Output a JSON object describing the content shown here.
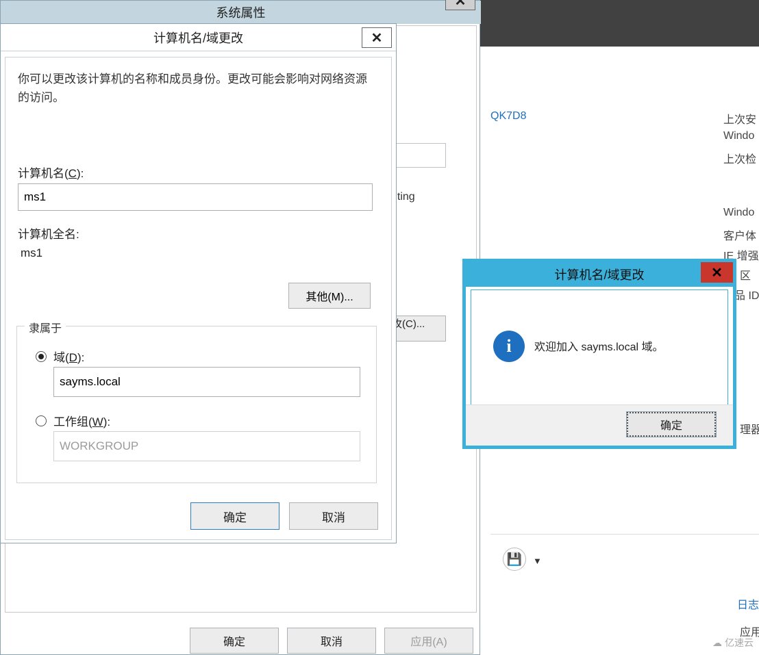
{
  "background": {
    "computer_link": "QK7D8",
    "labels": {
      "last_install": "上次安",
      "windows": "Windo",
      "last_check": "上次检",
      "windo2": "Windo",
      "customer": "客户体",
      "ie_enhance": "IE 增强",
      "zone": "区",
      "product_id": "品 ID",
      "processor": "理器",
      "log": "日志",
      "app": "应用"
    },
    "network_hint": "nting",
    "change_button_partial": "攻(C)..."
  },
  "system_properties": {
    "title": "系统属性",
    "close": "✕",
    "ok": "确定",
    "cancel": "取消",
    "apply": "应用(A)"
  },
  "name_change": {
    "title": "计算机名/域更改",
    "close": "✕",
    "description": "你可以更改该计算机的名称和成员身份。更改可能会影响对网络资源的访问。",
    "computer_name_label_pre": "计算机名(",
    "computer_name_label_u": "C",
    "computer_name_label_post": "):",
    "computer_name_value": "ms1",
    "full_name_label": "计算机全名:",
    "full_name_value": "ms1",
    "more_button": "其他(M)...",
    "member_of": "隶属于",
    "domain_label_pre": "域(",
    "domain_label_u": "D",
    "domain_label_post": "):",
    "domain_value": "sayms.local",
    "workgroup_label_pre": "工作组(",
    "workgroup_label_u": "W",
    "workgroup_label_post": "):",
    "workgroup_value": "WORKGROUP",
    "ok": "确定",
    "cancel": "取消"
  },
  "msgbox": {
    "title": "计算机名/域更改",
    "close": "✕",
    "icon": "i",
    "text": "欢迎加入 sayms.local 域。",
    "ok": "确定"
  },
  "watermark": "亿速云"
}
